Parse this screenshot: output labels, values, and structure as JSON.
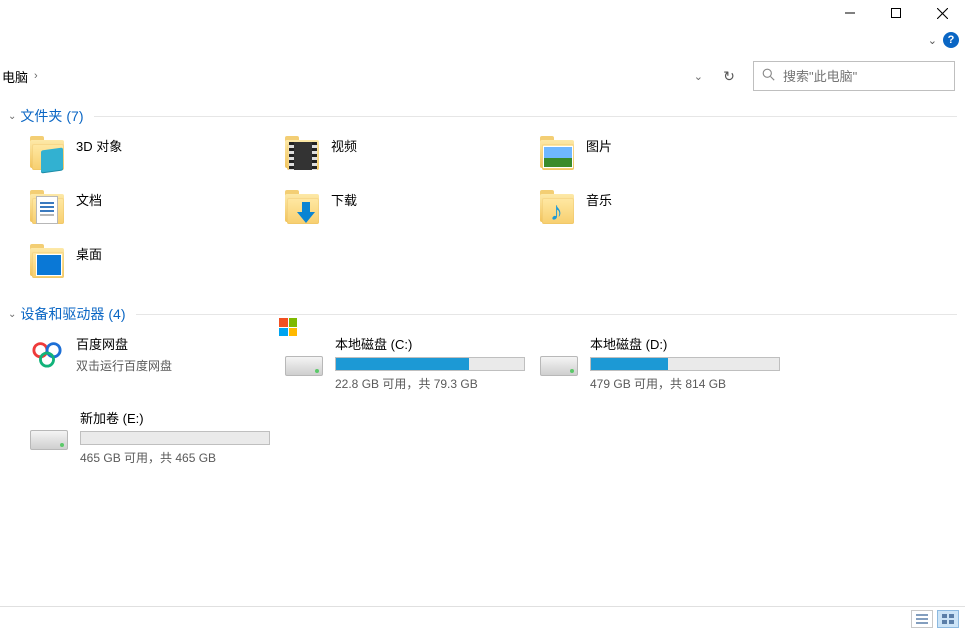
{
  "window": {
    "minimize_tip": "最小化",
    "maximize_tip": "最大化",
    "close_tip": "关闭"
  },
  "ribbon": {
    "collapse_glyph": "⌄",
    "help_glyph": "?"
  },
  "address": {
    "crumb": "电脑",
    "sep_glyph": "›",
    "dropdown_glyph": "⌄",
    "refresh_glyph": "↻"
  },
  "search": {
    "placeholder": "搜索\"此电脑\""
  },
  "groups": {
    "folders": {
      "label": "文件夹",
      "count": "(7)"
    },
    "devices": {
      "label": "设备和驱动器",
      "count": "(4)"
    }
  },
  "folders": [
    {
      "label": "3D 对象",
      "overlay": "3d"
    },
    {
      "label": "视频",
      "overlay": "video"
    },
    {
      "label": "图片",
      "overlay": "pic"
    },
    {
      "label": "文档",
      "overlay": "doc"
    },
    {
      "label": "下载",
      "overlay": "down"
    },
    {
      "label": "音乐",
      "overlay": "music"
    },
    {
      "label": "桌面",
      "overlay": "desktop"
    }
  ],
  "drives": {
    "baidu": {
      "name": "百度网盘",
      "sub": "双击运行百度网盘"
    },
    "c": {
      "name": "本地磁盘 (C:)",
      "usage": "22.8 GB 可用，共 79.3 GB",
      "fill_pct": 71
    },
    "d": {
      "name": "本地磁盘 (D:)",
      "usage": "479 GB 可用，共 814 GB",
      "fill_pct": 41
    },
    "e": {
      "name": "新加卷 (E:)",
      "usage": "465 GB 可用，共 465 GB",
      "fill_pct": 0
    }
  }
}
